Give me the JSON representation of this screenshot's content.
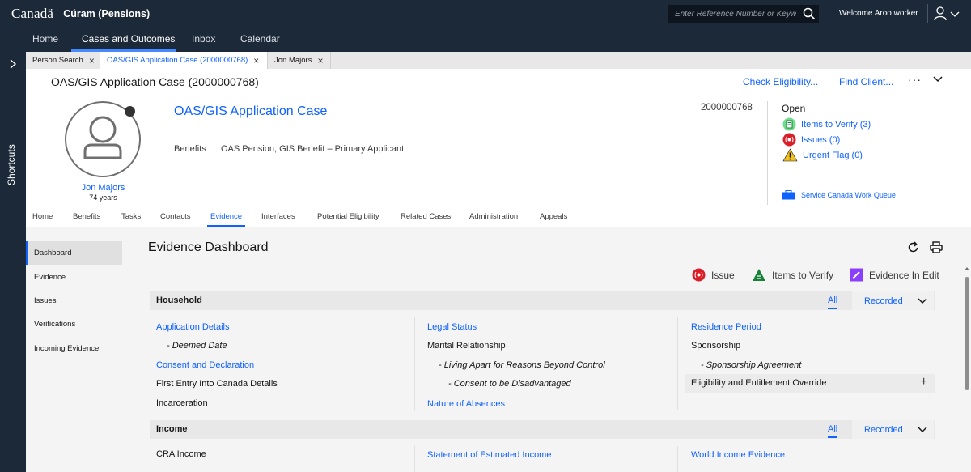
{
  "topbar": {
    "brand": "Canadä",
    "app_title": "Cúram (Pensions)",
    "search_placeholder": "Enter Reference Number or Keyword",
    "welcome": "Welcome Aroo worker"
  },
  "nav": {
    "items": [
      {
        "label": "Home"
      },
      {
        "label": "Cases and Outcomes"
      },
      {
        "label": "Inbox"
      },
      {
        "label": "Calendar"
      }
    ],
    "active": "Cases and Outcomes"
  },
  "shortcuts": {
    "label": "Shortcuts"
  },
  "tabs": [
    {
      "label": "Person Search"
    },
    {
      "label": "OAS/GIS Application Case (2000000768)"
    },
    {
      "label": "Jon Majors"
    }
  ],
  "header": {
    "title": "OAS/GIS Application Case (2000000768)",
    "check_eligibility": "Check Eligibility...",
    "find_client": "Find Client...",
    "more": "···"
  },
  "person": {
    "name": "Jon Majors",
    "age": "74 years"
  },
  "case": {
    "name": "OAS/GIS Application Case",
    "benefits_label": "Benefits",
    "benefits_value": "OAS Pension, GIS Benefit – Primary Applicant",
    "number": "2000000768",
    "status": "Open",
    "items_to_verify": "Items to Verify (3)",
    "issues": "Issues (0)",
    "urgent_flag": "Urgent Flag (0)",
    "work_queue": "Service Canada Work Queue"
  },
  "case_tabs": [
    {
      "label": "Home"
    },
    {
      "label": "Benefits"
    },
    {
      "label": "Tasks"
    },
    {
      "label": "Contacts"
    },
    {
      "label": "Evidence"
    },
    {
      "label": "Interfaces"
    },
    {
      "label": "Potential Eligibility"
    },
    {
      "label": "Related Cases"
    },
    {
      "label": "Administration"
    },
    {
      "label": "Appeals"
    }
  ],
  "left_nav": [
    {
      "label": "Dashboard"
    },
    {
      "label": "Evidence"
    },
    {
      "label": "Issues"
    },
    {
      "label": "Verifications"
    },
    {
      "label": "Incoming Evidence"
    }
  ],
  "dashboard": {
    "title": "Evidence Dashboard",
    "legend": {
      "issue": "Issue",
      "verify": "Items to Verify",
      "edit": "Evidence In Edit"
    },
    "colors": {
      "issue": "#da1e28",
      "verify": "#198038",
      "edit": "#8a3ffc"
    },
    "household": {
      "title": "Household",
      "filter_all": "All",
      "filter_recorded": "Recorded",
      "col1": {
        "application_details": "Application Details",
        "deemed_date": "- Deemed Date",
        "consent": "Consent and Declaration",
        "first_entry": "First Entry Into Canada Details",
        "incarceration": "Incarceration"
      },
      "col2": {
        "legal_status": "Legal Status",
        "marital": "Marital Relationship",
        "living_apart": "- Living Apart for Reasons Beyond Control",
        "consent_disadv": "- Consent to be Disadvantaged",
        "absences": "Nature of Absences"
      },
      "col3": {
        "residence": "Residence Period",
        "sponsorship": "Sponsorship",
        "sponsorship_agreement": "- Sponsorship Agreement",
        "override": "Eligibility and Entitlement Override"
      }
    },
    "income": {
      "title": "Income",
      "filter_all": "All",
      "filter_recorded": "Recorded",
      "cra": "CRA Income",
      "estimated": "Statement of Estimated Income",
      "world": "World Income Evidence"
    }
  }
}
